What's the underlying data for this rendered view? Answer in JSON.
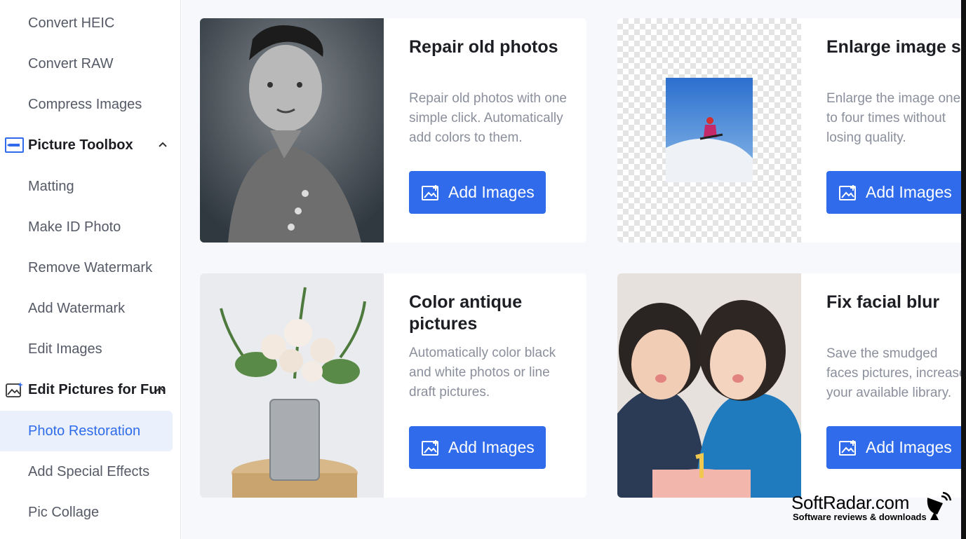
{
  "sidebar": {
    "items_top": [
      {
        "label": "Convert HEIC"
      },
      {
        "label": "Convert RAW"
      },
      {
        "label": "Compress Images"
      }
    ],
    "group_toolbox": {
      "label": "Picture Toolbox",
      "icon": "toolbox-icon"
    },
    "items_toolbox": [
      {
        "label": "Matting"
      },
      {
        "label": "Make ID Photo"
      },
      {
        "label": "Remove Watermark"
      },
      {
        "label": "Add Watermark"
      },
      {
        "label": "Edit Images"
      }
    ],
    "group_fun": {
      "label": "Edit Pictures for Fun",
      "icon": "magic-image-icon"
    },
    "items_fun": [
      {
        "label": "Photo Restoration",
        "active": true
      },
      {
        "label": "Add Special Effects"
      },
      {
        "label": "Pic Collage"
      }
    ]
  },
  "cards": [
    {
      "title": "Repair old photos",
      "desc": "Repair old photos with one simple click. Automatically add colors to them.",
      "button": "Add Images",
      "image": "old-portrait-photo"
    },
    {
      "title": "Enlarge image size",
      "desc": "Enlarge the image one to four times without losing quality.",
      "button": "Add Images",
      "image": "skier-photo"
    },
    {
      "title": "Color antique pictures",
      "desc": "Automatically color black and white photos or line draft pictures.",
      "button": "Add Images",
      "image": "flower-vase-photo"
    },
    {
      "title": "Fix facial blur",
      "desc": "Save the smudged faces pictures, increase your available library.",
      "button": "Add Images",
      "image": "couple-selfie-photo"
    }
  ],
  "watermark": {
    "brand": "SoftRadar.com",
    "tagline": "Software reviews & downloads"
  },
  "colors": {
    "accent": "#2f6bea",
    "active_bg": "#eaf1fc",
    "main_bg": "#f7f8fb"
  }
}
